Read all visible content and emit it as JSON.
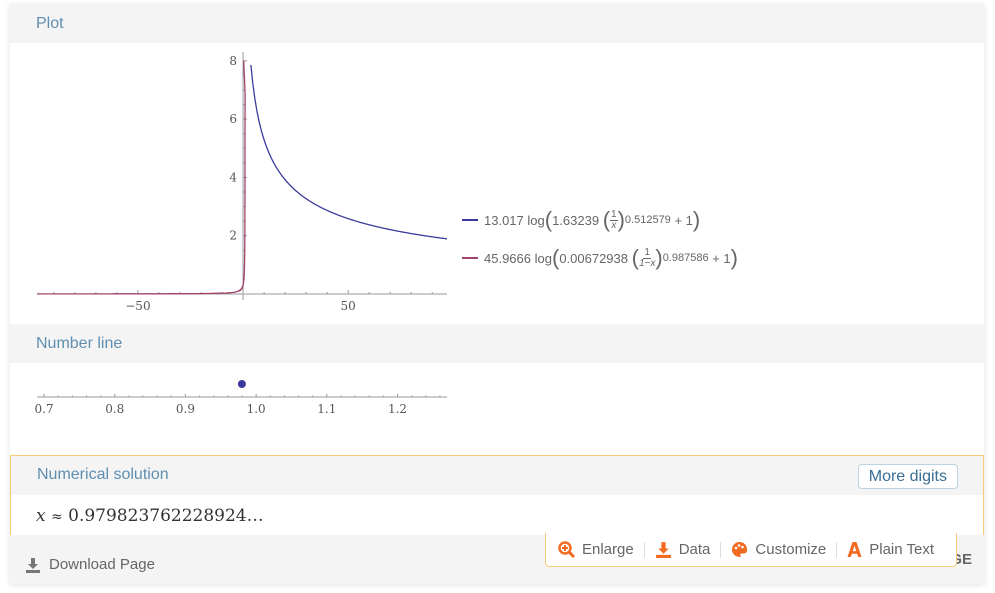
{
  "pods": {
    "plot": {
      "title": "Plot"
    },
    "number_line": {
      "title": "Number line"
    },
    "numerical_solution": {
      "title": "Numerical solution",
      "variable": "x",
      "approx_symbol": "≈",
      "value": "0.979823762228924…",
      "more_digits_label": "More digits"
    }
  },
  "legend": [
    {
      "coef": "13.017",
      "fn": "log",
      "inner_coef": "1.63239",
      "frac_num": "1",
      "frac_den": "x",
      "exponent": "0.512579",
      "plus": "+ 1",
      "color": "#3b3b9e"
    },
    {
      "coef": "45.9666",
      "fn": "log",
      "inner_coef": "0.00672938",
      "frac_num": "1",
      "frac_den": "1−x",
      "exponent": "0.987586",
      "plus": "+ 1",
      "color": "#a0436e"
    }
  ],
  "chart_data": [
    {
      "type": "line",
      "title": "Plot",
      "xlabel": "",
      "ylabel": "",
      "xlim": [
        -98,
        97
      ],
      "ylim": [
        0,
        8.2
      ],
      "x_ticks": [
        -50,
        50
      ],
      "x_tick_labels": [
        "−50",
        "50"
      ],
      "y_ticks": [
        2,
        4,
        6,
        8
      ],
      "y_tick_labels": [
        "2",
        "4",
        "6",
        "8"
      ],
      "grid": false,
      "legend_position": "right",
      "series": [
        {
          "name": "13.017 log(1.63239 (1/x)^0.512579 + 1)",
          "color": "#3b3b9e",
          "function": "13.017*ln(1.63239*(1/x)^0.512579+1)",
          "domain": [
            3.5,
            97
          ]
        },
        {
          "name": "45.9666 log(0.00672938 (1/(1-x))^0.987586 + 1)",
          "color": "#a0436e",
          "function": "45.9666*ln(0.00672938*(1/(1-x))^0.987586+1)",
          "domain": [
            -98,
            0.99
          ]
        }
      ]
    },
    {
      "type": "scatter",
      "title": "Number line",
      "xlim": [
        0.69,
        1.27
      ],
      "x_ticks": [
        0.7,
        0.8,
        0.9,
        1.0,
        1.1,
        1.2
      ],
      "x_tick_labels": [
        "0.7",
        "0.8",
        "0.9",
        "1.0",
        "1.1",
        "1.2"
      ],
      "points": [
        {
          "x": 0.979823762228924,
          "color": "#3b3b9e"
        }
      ]
    }
  ],
  "footer": {
    "download_label": "Download Page",
    "truncated_label": "GE"
  },
  "toolbar": {
    "items": [
      {
        "label": "Enlarge",
        "icon": "zoom-in-icon"
      },
      {
        "label": "Data",
        "icon": "download-icon"
      },
      {
        "label": "Customize",
        "icon": "palette-icon"
      },
      {
        "label": "Plain Text",
        "icon": "text-a-icon"
      }
    ],
    "accent": "#f26b21"
  }
}
